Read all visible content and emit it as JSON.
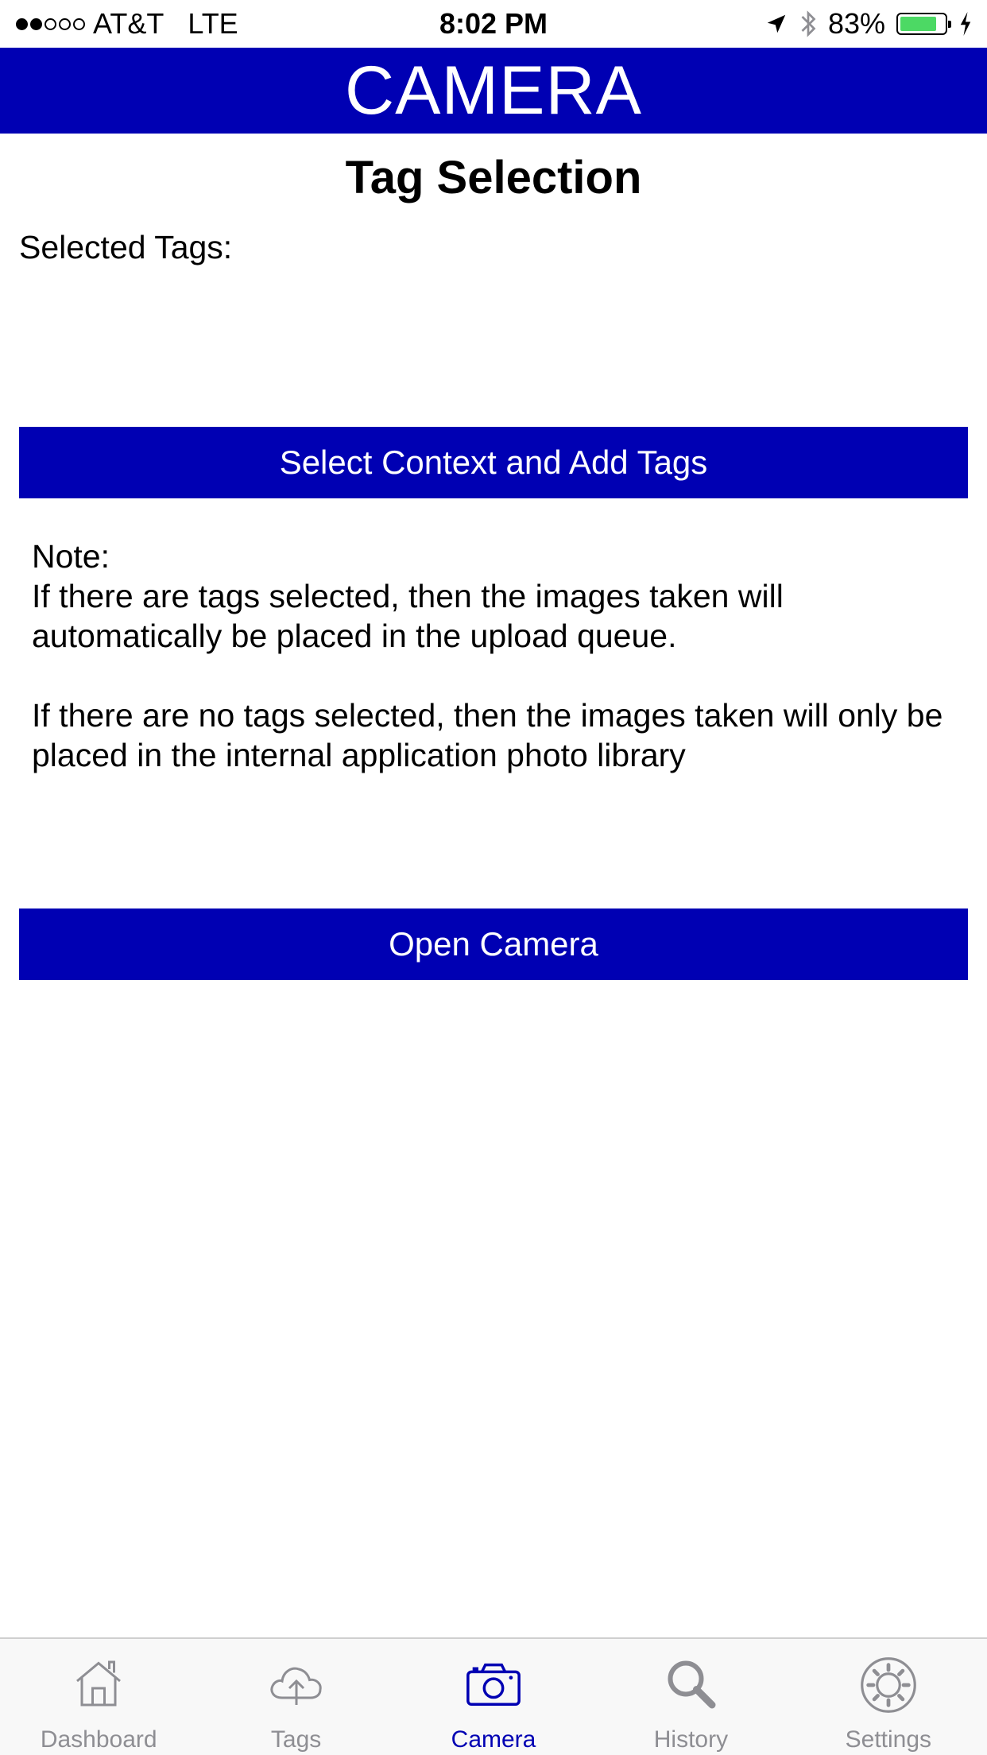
{
  "status_bar": {
    "carrier": "AT&T",
    "network": "LTE",
    "time": "8:02 PM",
    "battery_percent_text": "83%",
    "battery_level": 0.83,
    "battery_color": "#4cd964",
    "signal_bars_filled": 2,
    "signal_bars_total": 5,
    "icons": [
      "location-arrow-icon",
      "bluetooth-icon",
      "battery-icon",
      "charging-bolt-icon"
    ]
  },
  "header": {
    "title": "CAMERA",
    "color": "#0000b3"
  },
  "page": {
    "title": "Tag Selection",
    "selected_tags_label": "Selected Tags:",
    "select_button": "Select Context and Add Tags",
    "note": {
      "heading": "Note:",
      "line1": "If there are tags selected, then the images taken will automatically be placed in the upload queue.",
      "line2": "If there are no tags selected, then the images taken will only be placed in the internal application photo library"
    },
    "open_camera_button": "Open Camera"
  },
  "tab_bar": {
    "active_color": "#0000b3",
    "inactive_color": "#8e8e93",
    "tabs": [
      {
        "label": "Dashboard",
        "icon": "house-icon",
        "active": false
      },
      {
        "label": "Tags",
        "icon": "cloud-upload-icon",
        "active": false
      },
      {
        "label": "Camera",
        "icon": "camera-icon",
        "active": true
      },
      {
        "label": "History",
        "icon": "magnifier-icon",
        "active": false
      },
      {
        "label": "Settings",
        "icon": "gear-icon",
        "active": false
      }
    ]
  }
}
